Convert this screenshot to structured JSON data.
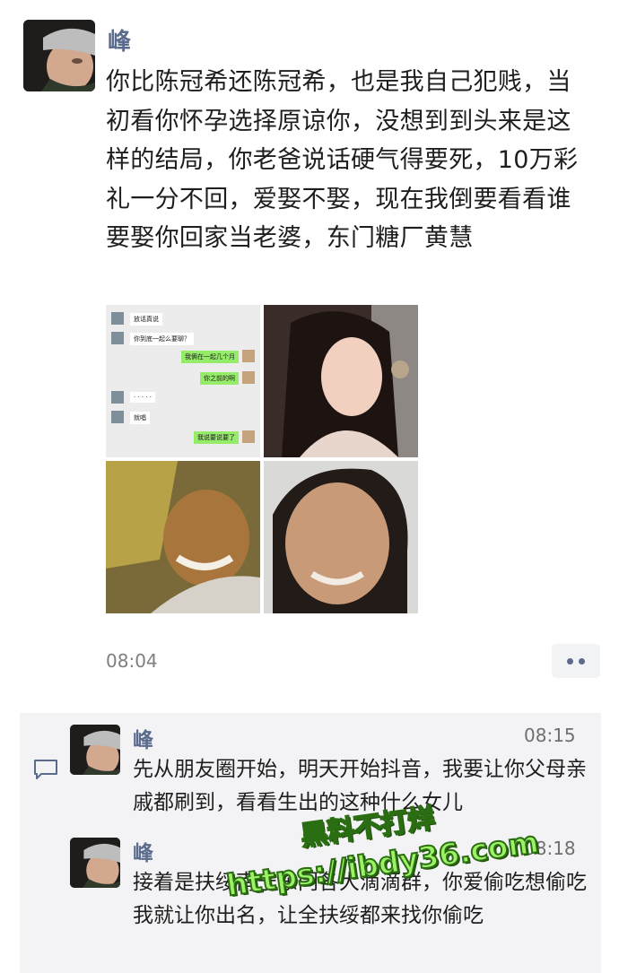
{
  "post": {
    "author": "峰",
    "text": "你比陈冠希还陈冠希，也是我自己犯贱，当初看你怀孕选择原谅你，没想到到头来是这样的结局，你老爸说话硬气得要死，10万彩礼一分不回，爱娶不娶，现在我倒要看看谁要娶你回家当老婆，东门糖厂黄慧",
    "time": "08:04"
  },
  "chat_screenshot": {
    "messages": [
      "放话真说",
      "你到底一起么要聊？",
      "我俩在一起几个月",
      "你之前的啊",
      "·  ·  ·  ·  ·",
      "就唱",
      "我说要说要了"
    ]
  },
  "comments": [
    {
      "author": "峰",
      "time": "08:15",
      "text": "先从朋友圈开始，明天开始抖音，我要让你父母亲戚都刷到，看看生出的这种什么女儿"
    },
    {
      "author": "峰",
      "time": "08:18",
      "text": "接着是扶绥南宁东门各大滴滴群，你爱偷吃想偷吃我就让你出名，让全扶绥都来找你偷吃"
    }
  ],
  "watermark": {
    "line1": "黑料不打烊",
    "line2": "https://ibdy36.com"
  },
  "colors": {
    "name": "#5a6b8c",
    "watermark": "#9cf266",
    "wechat_green": "#95ec69"
  }
}
